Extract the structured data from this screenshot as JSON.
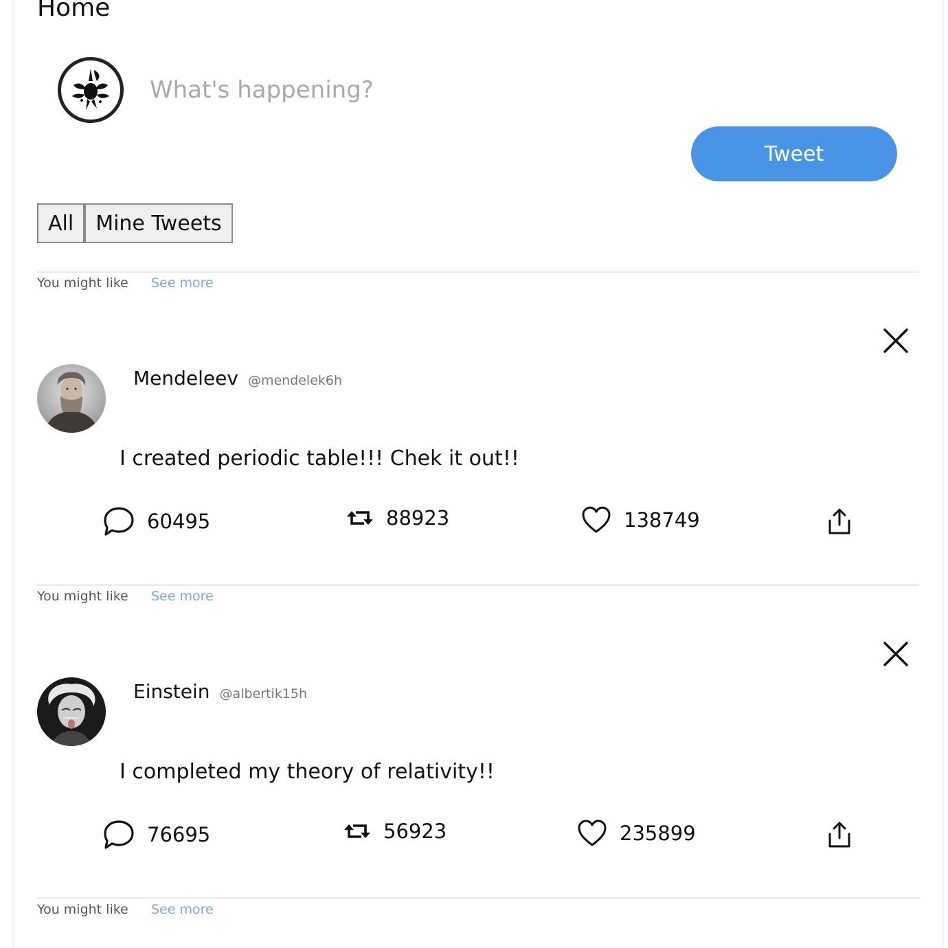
{
  "header": {
    "title": "Home"
  },
  "compose": {
    "placeholder": "What's happening?",
    "tweet_button": "Tweet"
  },
  "filters": [
    {
      "label": "All"
    },
    {
      "label": "Mine Tweets"
    }
  ],
  "suggestion": {
    "label": "You might like",
    "link": "See more"
  },
  "tweets": [
    {
      "name": "Mendeleev",
      "handle": "@mendelek6h",
      "text": "I created periodic table!!! Chek it out!!",
      "comments": "60495",
      "retweets": "88923",
      "likes": "138749"
    },
    {
      "name": "Einstein",
      "handle": "@albertik15h",
      "text": "I completed my theory of relativity!!",
      "comments": "76695",
      "retweets": "56923",
      "likes": "235899"
    }
  ],
  "colors": {
    "accent": "#4a94e8",
    "link": "#7ea6dc",
    "muted": "#555555"
  },
  "icons": {
    "close": "close-icon",
    "comment": "comment-icon",
    "retweet": "retweet-icon",
    "like": "heart-icon",
    "share": "share-icon"
  }
}
